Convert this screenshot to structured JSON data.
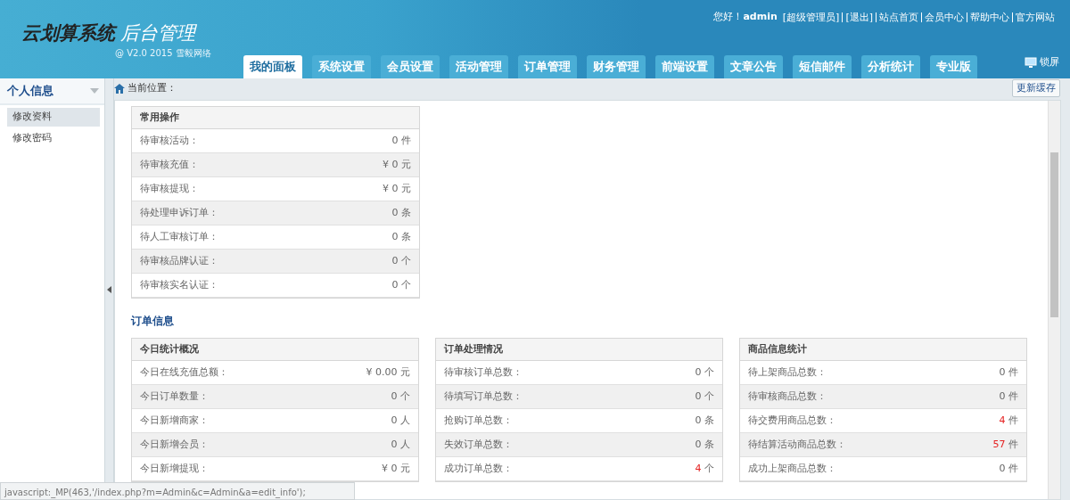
{
  "header": {
    "logo_main": "云划算系统",
    "logo_sub": "后台管理",
    "version": "@ V2.0 2015 雪毅网络",
    "greeting": "您好！",
    "user": "admin",
    "role": "[超级管理员]",
    "links": [
      "[退出]",
      "站点首页",
      "会员中心",
      "帮助中心",
      "官方网站"
    ],
    "lock": "锁屏"
  },
  "tabs": [
    {
      "label": "我的面板",
      "selected": true
    },
    {
      "label": "系统设置",
      "selected": false
    },
    {
      "label": "会员设置",
      "selected": false
    },
    {
      "label": "活动管理",
      "selected": false
    },
    {
      "label": "订单管理",
      "selected": false
    },
    {
      "label": "财务管理",
      "selected": false
    },
    {
      "label": "前端设置",
      "selected": false
    },
    {
      "label": "文章公告",
      "selected": false
    },
    {
      "label": "短信邮件",
      "selected": false
    },
    {
      "label": "分析统计",
      "selected": false
    },
    {
      "label": "专业版",
      "selected": false
    }
  ],
  "sidebar": {
    "title": "个人信息",
    "items": [
      {
        "label": "修改资料",
        "selected": true
      },
      {
        "label": "修改密码",
        "selected": false
      }
    ]
  },
  "breadcrumb": "当前位置：",
  "refresh_button": "更新缓存",
  "common_panel": {
    "title": "常用操作",
    "rows": [
      {
        "label": "待审核活动：",
        "number": "0",
        "unit": "件",
        "alert": false
      },
      {
        "label": "待审核充值：",
        "prefix": "¥",
        "number": "0",
        "unit": "元",
        "alert": false
      },
      {
        "label": "待审核提现：",
        "prefix": "¥",
        "number": "0",
        "unit": "元",
        "alert": false
      },
      {
        "label": "待处理申诉订单：",
        "number": "0",
        "unit": "条",
        "alert": false
      },
      {
        "label": "待人工审核订单：",
        "number": "0",
        "unit": "条",
        "alert": false
      },
      {
        "label": "待审核品牌认证：",
        "number": "0",
        "unit": "个",
        "alert": false
      },
      {
        "label": "待审核实名认证：",
        "number": "0",
        "unit": "个",
        "alert": false
      }
    ]
  },
  "section_title": "订单信息",
  "panels": [
    {
      "title": "今日统计概况",
      "rows": [
        {
          "label": "今日在线充值总额：",
          "prefix": "¥",
          "number": "0.00",
          "unit": "元",
          "alert": false
        },
        {
          "label": "今日订单数量：",
          "number": "0",
          "unit": "个",
          "alert": false
        },
        {
          "label": "今日新增商家：",
          "number": "0",
          "unit": "人",
          "alert": false
        },
        {
          "label": "今日新增会员：",
          "number": "0",
          "unit": "人",
          "alert": false
        },
        {
          "label": "今日新增提现：",
          "prefix": "¥",
          "number": "0",
          "unit": "元",
          "alert": false
        }
      ]
    },
    {
      "title": "订单处理情况",
      "rows": [
        {
          "label": "待审核订单总数：",
          "number": "0",
          "unit": "个",
          "alert": false
        },
        {
          "label": "待填写订单总数：",
          "number": "0",
          "unit": "个",
          "alert": false
        },
        {
          "label": "抢购订单总数：",
          "number": "0",
          "unit": "条",
          "alert": false
        },
        {
          "label": "失效订单总数：",
          "number": "0",
          "unit": "条",
          "alert": false
        },
        {
          "label": "成功订单总数：",
          "number": "4",
          "unit": "个",
          "alert": true
        }
      ]
    },
    {
      "title": "商品信息统计",
      "rows": [
        {
          "label": "待上架商品总数：",
          "number": "0",
          "unit": "件",
          "alert": false
        },
        {
          "label": "待审核商品总数：",
          "number": "0",
          "unit": "件",
          "alert": false
        },
        {
          "label": "待交费用商品总数：",
          "number": "4",
          "unit": "件",
          "alert": true
        },
        {
          "label": "待结算活动商品总数：",
          "number": "57",
          "unit": "件",
          "alert": true
        },
        {
          "label": "成功上架商品总数：",
          "number": "0",
          "unit": "件",
          "alert": false
        }
      ]
    }
  ],
  "status_bar": "javascript:_MP(463,'/index.php?m=Admin&c=Admin&a=edit_info');"
}
